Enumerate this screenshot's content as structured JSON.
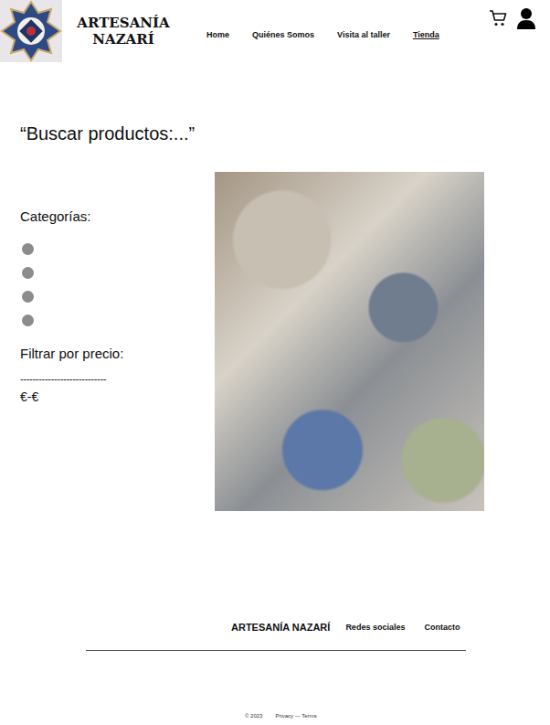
{
  "header": {
    "brand_lines": [
      "ARTESANÍA",
      "NAZARÍ"
    ],
    "nav": [
      {
        "label": "Home",
        "selected": false
      },
      {
        "label": "Quiénes Somos",
        "selected": false
      },
      {
        "label": "Visita al taller",
        "selected": false
      },
      {
        "label": "Tienda",
        "selected": true
      }
    ]
  },
  "search": {
    "placeholder": "“Buscar productos:...”"
  },
  "categories": {
    "label": "Categorías:",
    "items": [
      {
        "selected": false
      },
      {
        "selected": false
      },
      {
        "selected": false
      },
      {
        "selected": false
      }
    ]
  },
  "price_filter": {
    "label": "Filtrar por precio:",
    "slider": "----------------------------",
    "range": "€-€"
  },
  "footer": {
    "brand": "ARTESANÍA NAZARÍ",
    "links": [
      "Redes sociales",
      "Contacto"
    ],
    "copyright": "© 2023",
    "legal": "Privacy — Terms"
  }
}
